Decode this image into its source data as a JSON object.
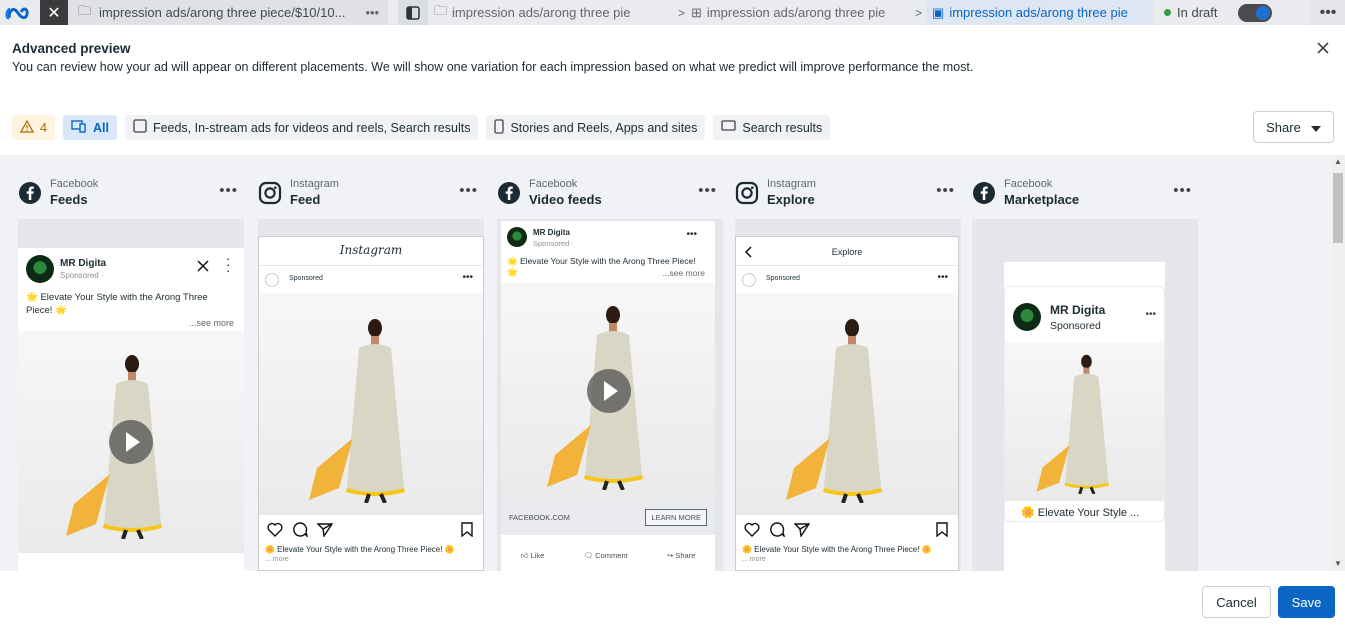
{
  "topbar": {
    "tab_title": "impression ads/arong three piece/$10/10...",
    "crumbs": [
      "impression ads/arong three pie",
      "impression ads/arong three pie",
      "impression ads/arong three pie"
    ],
    "status": "In draft"
  },
  "dialog": {
    "title": "Advanced preview",
    "description": "You can review how your ad will appear on different placements. We will show one variation for each impression based on what we predict will improve performance the most."
  },
  "filters": {
    "warning_count": "4",
    "all_label": "All",
    "feeds_label": "Feeds, In-stream ads for videos and reels, Search results",
    "stories_label": "Stories and Reels, Apps and sites",
    "search_label": "Search results",
    "share_label": "Share"
  },
  "columns": [
    {
      "platform": "Facebook",
      "placement": "Feeds"
    },
    {
      "platform": "Instagram",
      "placement": "Feed"
    },
    {
      "platform": "Facebook",
      "placement": "Video feeds"
    },
    {
      "platform": "Instagram",
      "placement": "Explore"
    },
    {
      "platform": "Facebook",
      "placement": "Marketplace"
    }
  ],
  "ad": {
    "page_name": "MR Digita",
    "sponsored": "Sponsored",
    "sponsored_dot": "Sponsored ·",
    "caption": "🌟 Elevate Your Style with the Arong Three Piece! 🌟",
    "ig_caption": "🌼 Elevate Your Style with the Arong Three Piece! 🌼",
    "ig_more": "... more",
    "see_more": "...see more",
    "instagram_wordmark": "Instagram",
    "explore_title": "Explore",
    "link_domain": "FACEBOOK.COM",
    "cta": "LEARN MORE",
    "like": "Like",
    "comment": "Comment",
    "share": "Share",
    "marketplace_title": "🌼 Elevate Your Style ..."
  },
  "footer": {
    "cancel": "Cancel",
    "save": "Save"
  }
}
